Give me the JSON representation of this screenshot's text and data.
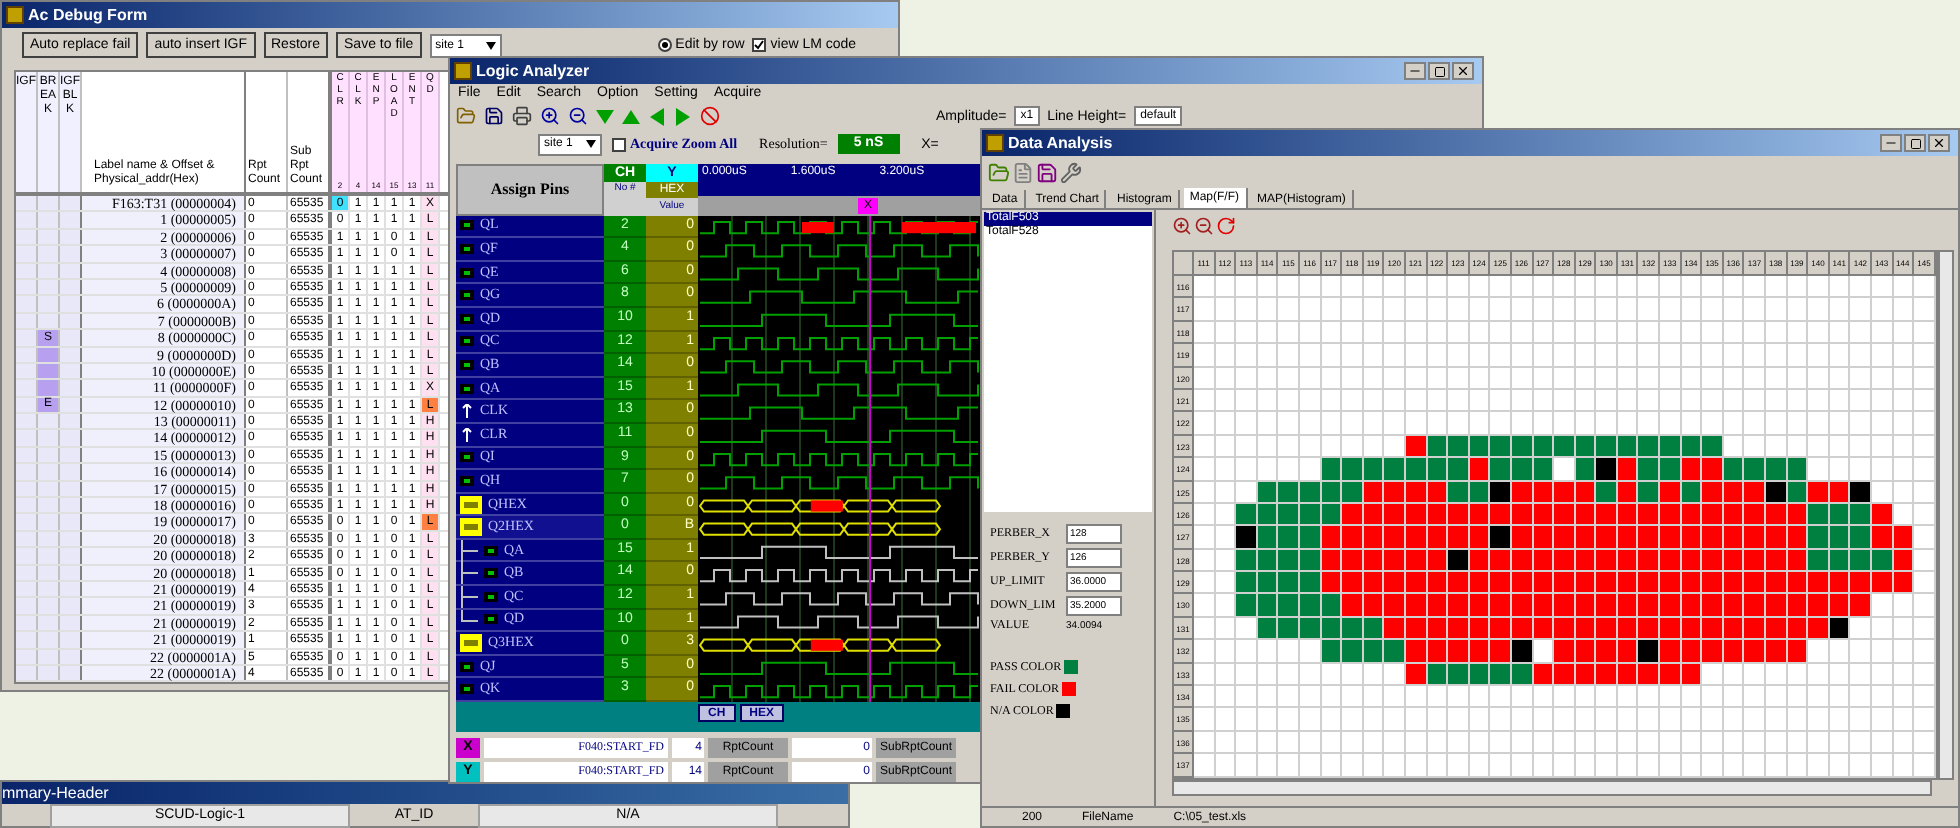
{
  "debug": {
    "title": "Ac Debug Form",
    "buttons": [
      "Auto replace fail",
      "auto insert IGF",
      "Restore",
      "Save to file"
    ],
    "site": "site 1",
    "edit_by_row": {
      "label": "Edit by row",
      "selected": true
    },
    "view_lm_code": {
      "label": "view LM code",
      "checked": true
    },
    "flag_columns": [
      "IGF",
      "BREAK",
      "IGFBLK"
    ],
    "label_header": "Label name & Offset & Physical_addr(Hex)",
    "rpt_header": "Rpt Count",
    "sub_header": "Sub Rpt Count",
    "pin_columns": [
      {
        "name": "CLR",
        "num": "2"
      },
      {
        "name": "CLK",
        "num": "4"
      },
      {
        "name": "ENP",
        "num": "14"
      },
      {
        "name": "LOAD",
        "num": "15"
      },
      {
        "name": "ENT",
        "num": "13"
      },
      {
        "name": "QD",
        "num": "11"
      }
    ],
    "rows": [
      {
        "label": "F163:T31 (00000004)",
        "rpt": "0",
        "sub": "65535",
        "pins": [
          "0",
          "1",
          "1",
          "1",
          "1",
          "X"
        ],
        "cursor": true,
        "fail": false,
        "in_break": false
      },
      {
        "label": "1 (00000005)",
        "rpt": "0",
        "sub": "65535",
        "pins": [
          "0",
          "1",
          "1",
          "1",
          "1",
          "L"
        ],
        "cursor": false,
        "fail": false,
        "in_break": false
      },
      {
        "label": "2 (00000006)",
        "rpt": "0",
        "sub": "65535",
        "pins": [
          "1",
          "1",
          "1",
          "0",
          "1",
          "L"
        ],
        "cursor": false,
        "fail": false,
        "in_break": false
      },
      {
        "label": "3 (00000007)",
        "rpt": "0",
        "sub": "65535",
        "pins": [
          "1",
          "1",
          "1",
          "0",
          "1",
          "L"
        ],
        "cursor": false,
        "fail": false,
        "in_break": false
      },
      {
        "label": "4 (00000008)",
        "rpt": "0",
        "sub": "65535",
        "pins": [
          "1",
          "1",
          "1",
          "1",
          "1",
          "L"
        ],
        "cursor": false,
        "fail": false,
        "in_break": false
      },
      {
        "label": "5 (00000009)",
        "rpt": "0",
        "sub": "65535",
        "pins": [
          "1",
          "1",
          "1",
          "1",
          "1",
          "L"
        ],
        "cursor": false,
        "fail": false,
        "in_break": false
      },
      {
        "label": "6 (0000000A)",
        "rpt": "0",
        "sub": "65535",
        "pins": [
          "1",
          "1",
          "1",
          "1",
          "1",
          "L"
        ],
        "cursor": false,
        "fail": false,
        "in_break": false
      },
      {
        "label": "7 (0000000B)",
        "rpt": "0",
        "sub": "65535",
        "pins": [
          "1",
          "1",
          "1",
          "1",
          "1",
          "L"
        ],
        "cursor": false,
        "fail": false,
        "in_break": false
      },
      {
        "label": "8 (0000000C)",
        "rpt": "0",
        "sub": "65535",
        "pins": [
          "1",
          "1",
          "1",
          "1",
          "1",
          "L"
        ],
        "cursor": false,
        "fail": false,
        "in_break": true,
        "break_label": "S"
      },
      {
        "label": "9 (0000000D)",
        "rpt": "0",
        "sub": "65535",
        "pins": [
          "1",
          "1",
          "1",
          "1",
          "1",
          "L"
        ],
        "cursor": false,
        "fail": false,
        "in_break": true
      },
      {
        "label": "10 (0000000E)",
        "rpt": "0",
        "sub": "65535",
        "pins": [
          "1",
          "1",
          "1",
          "1",
          "1",
          "L"
        ],
        "cursor": false,
        "fail": false,
        "in_break": true
      },
      {
        "label": "11 (0000000F)",
        "rpt": "0",
        "sub": "65535",
        "pins": [
          "1",
          "1",
          "1",
          "1",
          "1",
          "X"
        ],
        "cursor": false,
        "fail": false,
        "in_break": true
      },
      {
        "label": "12 (00000010)",
        "rpt": "0",
        "sub": "65535",
        "pins": [
          "1",
          "1",
          "1",
          "1",
          "1",
          "L"
        ],
        "cursor": false,
        "fail": true,
        "in_break": true,
        "break_label": "E"
      },
      {
        "label": "13 (00000011)",
        "rpt": "0",
        "sub": "65535",
        "pins": [
          "1",
          "1",
          "1",
          "1",
          "1",
          "H"
        ],
        "cursor": false,
        "fail": false,
        "in_break": false
      },
      {
        "label": "14 (00000012)",
        "rpt": "0",
        "sub": "65535",
        "pins": [
          "1",
          "1",
          "1",
          "1",
          "1",
          "H"
        ],
        "cursor": false,
        "fail": false,
        "in_break": false
      },
      {
        "label": "15 (00000013)",
        "rpt": "0",
        "sub": "65535",
        "pins": [
          "1",
          "1",
          "1",
          "1",
          "1",
          "H"
        ],
        "cursor": false,
        "fail": false,
        "in_break": false
      },
      {
        "label": "16 (00000014)",
        "rpt": "0",
        "sub": "65535",
        "pins": [
          "1",
          "1",
          "1",
          "1",
          "1",
          "H"
        ],
        "cursor": false,
        "fail": false,
        "in_break": false
      },
      {
        "label": "17 (00000015)",
        "rpt": "0",
        "sub": "65535",
        "pins": [
          "1",
          "1",
          "1",
          "1",
          "1",
          "H"
        ],
        "cursor": false,
        "fail": false,
        "in_break": false
      },
      {
        "label": "18 (00000016)",
        "rpt": "0",
        "sub": "65535",
        "pins": [
          "1",
          "1",
          "1",
          "1",
          "1",
          "H"
        ],
        "cursor": false,
        "fail": false,
        "in_break": false
      },
      {
        "label": "19 (00000017)",
        "rpt": "0",
        "sub": "65535",
        "pins": [
          "0",
          "1",
          "1",
          "0",
          "1",
          "L"
        ],
        "cursor": false,
        "fail": true,
        "in_break": false
      },
      {
        "label": "20 (00000018)",
        "rpt": "3",
        "sub": "65535",
        "pins": [
          "0",
          "1",
          "1",
          "0",
          "1",
          "L"
        ],
        "cursor": false,
        "fail": false,
        "in_break": false
      },
      {
        "label": "20 (00000018)",
        "rpt": "2",
        "sub": "65535",
        "pins": [
          "0",
          "1",
          "1",
          "0",
          "1",
          "L"
        ],
        "cursor": false,
        "fail": false,
        "in_break": false
      },
      {
        "label": "20 (00000018)",
        "rpt": "1",
        "sub": "65535",
        "pins": [
          "0",
          "1",
          "1",
          "0",
          "1",
          "L"
        ],
        "cursor": false,
        "fail": false,
        "in_break": false
      },
      {
        "label": "21 (00000019)",
        "rpt": "4",
        "sub": "65535",
        "pins": [
          "1",
          "1",
          "1",
          "0",
          "1",
          "L"
        ],
        "cursor": false,
        "fail": false,
        "in_break": false
      },
      {
        "label": "21 (00000019)",
        "rpt": "3",
        "sub": "65535",
        "pins": [
          "1",
          "1",
          "1",
          "0",
          "1",
          "L"
        ],
        "cursor": false,
        "fail": false,
        "in_break": false
      },
      {
        "label": "21 (00000019)",
        "rpt": "2",
        "sub": "65535",
        "pins": [
          "1",
          "1",
          "1",
          "0",
          "1",
          "L"
        ],
        "cursor": false,
        "fail": false,
        "in_break": false
      },
      {
        "label": "21 (00000019)",
        "rpt": "1",
        "sub": "65535",
        "pins": [
          "1",
          "1",
          "1",
          "0",
          "1",
          "L"
        ],
        "cursor": false,
        "fail": false,
        "in_break": false
      },
      {
        "label": "22 (0000001A)",
        "rpt": "5",
        "sub": "65535",
        "pins": [
          "0",
          "1",
          "1",
          "0",
          "1",
          "L"
        ],
        "cursor": false,
        "fail": false,
        "in_break": false
      },
      {
        "label": "22 (0000001A)",
        "rpt": "4",
        "sub": "65535",
        "pins": [
          "0",
          "1",
          "1",
          "0",
          "1",
          "L"
        ],
        "cursor": false,
        "fail": false,
        "in_break": false
      }
    ]
  },
  "logic": {
    "title": "Logic Analyzer",
    "menu": [
      "File",
      "Edit",
      "Search",
      "Option",
      "Setting",
      "Acquire"
    ],
    "amplitude_label": "Amplitude=",
    "amplitude": "x1",
    "line_height_label": "Line Height=",
    "line_height": "default",
    "site": "site 1",
    "acquire_zoom": {
      "label": "Acquire Zoom All",
      "checked": false
    },
    "resolution_label": "Resolution=",
    "resolution": "5 nS",
    "x_label": "X=",
    "headers": {
      "pins": "Assign Pins",
      "ch": "CH",
      "no": "No #",
      "y": "Y",
      "hex": "HEX",
      "value": "Value"
    },
    "time_ticks": [
      "0.000uS",
      "1.600uS",
      "3.200uS"
    ],
    "cursor_label": "X",
    "pins": [
      {
        "name": "QL",
        "ch": "2",
        "value": "0",
        "kind": "output"
      },
      {
        "name": "QF",
        "ch": "4",
        "value": "0",
        "kind": "output"
      },
      {
        "name": "QE",
        "ch": "6",
        "value": "0",
        "kind": "output"
      },
      {
        "name": "QG",
        "ch": "8",
        "value": "0",
        "kind": "output"
      },
      {
        "name": "QD",
        "ch": "10",
        "value": "1",
        "kind": "output"
      },
      {
        "name": "QC",
        "ch": "12",
        "value": "1",
        "kind": "output"
      },
      {
        "name": "QB",
        "ch": "14",
        "value": "0",
        "kind": "output"
      },
      {
        "name": "QA",
        "ch": "15",
        "value": "1",
        "kind": "output"
      },
      {
        "name": "CLK",
        "ch": "13",
        "value": "0",
        "kind": "input"
      },
      {
        "name": "CLR",
        "ch": "11",
        "value": "0",
        "kind": "input"
      },
      {
        "name": "QI",
        "ch": "9",
        "value": "0",
        "kind": "output"
      },
      {
        "name": "QH",
        "ch": "7",
        "value": "0",
        "kind": "output"
      },
      {
        "name": "QHEX",
        "ch": "0",
        "value": "0",
        "kind": "bus"
      },
      {
        "name": "Q2HEX",
        "ch": "0",
        "value": "B",
        "kind": "bus",
        "expanded": true,
        "children": [
          {
            "name": "QA",
            "ch": "15",
            "value": "1",
            "kind": "output"
          },
          {
            "name": "QB",
            "ch": "14",
            "value": "0",
            "kind": "output"
          },
          {
            "name": "QC",
            "ch": "12",
            "value": "1",
            "kind": "output"
          },
          {
            "name": "QD",
            "ch": "10",
            "value": "1",
            "kind": "output"
          }
        ]
      },
      {
        "name": "Q3HEX",
        "ch": "0",
        "value": "3",
        "kind": "bus"
      },
      {
        "name": "QJ",
        "ch": "5",
        "value": "0",
        "kind": "output"
      },
      {
        "name": "QK",
        "ch": "3",
        "value": "0",
        "kind": "output"
      }
    ],
    "bottom_buttons": [
      "CH",
      "HEX"
    ],
    "cursors": [
      {
        "label": "X",
        "color": "#cc00cc",
        "pattern": "F040:START_FD",
        "count": "4",
        "rpt_label": "RptCount",
        "rpt": "0",
        "sub_label": "SubRptCount"
      },
      {
        "label": "Y",
        "color": "#00c0c0",
        "pattern": "F040:START_FD",
        "count": "14",
        "rpt_label": "RptCount",
        "rpt": "0",
        "sub_label": "SubRptCount"
      }
    ]
  },
  "data": {
    "title": "Data Analysis",
    "tabs": [
      {
        "label": "Data",
        "selected": false
      },
      {
        "label": "Trend Chart",
        "selected": false
      },
      {
        "label": "Histogram",
        "selected": false
      },
      {
        "label": "Map(F/F)",
        "selected": true
      },
      {
        "label": "MAP(Histogram)",
        "selected": false
      }
    ],
    "list": [
      {
        "label": "TotalF503",
        "selected": true
      },
      {
        "label": "TotalF528",
        "selected": false
      }
    ],
    "params": [
      {
        "label": "PERBER_X",
        "value": "128"
      },
      {
        "label": "PERBER_Y",
        "value": "126"
      },
      {
        "label": "UP_LIMIT",
        "value": "36.0000"
      },
      {
        "label": "DOWN_LIM",
        "value": "35.2000"
      }
    ],
    "value_label": "VALUE",
    "value": "34.0094",
    "legend": [
      {
        "label": "PASS COLOR",
        "kind": "pass",
        "color": "#008040"
      },
      {
        "label": "FAIL COLOR",
        "kind": "fail",
        "color": "#ff0000"
      },
      {
        "label": "N/A COLOR",
        "kind": "na",
        "color": "#000000"
      }
    ],
    "map": {
      "columns": [
        "111",
        "112",
        "113",
        "114",
        "115",
        "116",
        "117",
        "118",
        "119",
        "120",
        "121",
        "122",
        "123",
        "124",
        "125",
        "126",
        "127",
        "128",
        "129",
        "130",
        "131",
        "132",
        "133",
        "134",
        "135",
        "136",
        "137",
        "138",
        "139",
        "140",
        "141",
        "142",
        "143",
        "144",
        "145"
      ],
      "rows": [
        {
          "label": "116"
        },
        {
          "label": "117"
        },
        {
          "label": "118"
        },
        {
          "label": "119"
        },
        {
          "label": "120"
        },
        {
          "label": "121"
        },
        {
          "label": "122"
        },
        {
          "label": "123",
          "cells": [
            {
              "kind": "blank"
            },
            {
              "kind": "blank"
            },
            {
              "kind": "blank"
            },
            {
              "kind": "blank"
            },
            {
              "kind": "blank"
            },
            {
              "kind": "blank"
            },
            {
              "kind": "blank"
            },
            {
              "kind": "blank"
            },
            {
              "kind": "blank"
            },
            {
              "kind": "blank"
            },
            {
              "kind": "fail"
            },
            {
              "kind": "pass"
            },
            {
              "kind": "pass"
            },
            {
              "kind": "pass"
            },
            {
              "kind": "pass"
            },
            {
              "kind": "pass"
            },
            {
              "kind": "pass"
            },
            {
              "kind": "pass"
            },
            {
              "kind": "pass"
            },
            {
              "kind": "pass"
            },
            {
              "kind": "pass"
            },
            {
              "kind": "pass"
            },
            {
              "kind": "pass"
            },
            {
              "kind": "pass"
            },
            {
              "kind": "pass"
            }
          ]
        },
        {
          "label": "124",
          "cells": [
            {
              "kind": "blank"
            },
            {
              "kind": "blank"
            },
            {
              "kind": "blank"
            },
            {
              "kind": "blank"
            },
            {
              "kind": "blank"
            },
            {
              "kind": "blank"
            },
            {
              "kind": "pass"
            },
            {
              "kind": "pass"
            },
            {
              "kind": "pass"
            },
            {
              "kind": "pass"
            },
            {
              "kind": "pass"
            },
            {
              "kind": "pass"
            },
            {
              "kind": "pass"
            },
            {
              "kind": "fail"
            },
            {
              "kind": "pass"
            },
            {
              "kind": "pass"
            },
            {
              "kind": "pass"
            },
            {
              "kind": "blank"
            },
            {
              "kind": "pass"
            },
            {
              "kind": "na"
            },
            {
              "kind": "fail"
            },
            {
              "kind": "pass"
            },
            {
              "kind": "pass"
            },
            {
              "kind": "fail"
            },
            {
              "kind": "fail"
            },
            {
              "kind": "pass"
            },
            {
              "kind": "pass"
            },
            {
              "kind": "pass"
            },
            {
              "kind": "pass"
            }
          ]
        },
        {
          "label": "125",
          "cells": [
            {
              "kind": "blank"
            },
            {
              "kind": "blank"
            },
            {
              "kind": "blank"
            },
            {
              "kind": "pass"
            },
            {
              "kind": "pass"
            },
            {
              "kind": "pass"
            },
            {
              "kind": "pass"
            },
            {
              "kind": "pass"
            },
            {
              "kind": "fail"
            },
            {
              "kind": "fail"
            },
            {
              "kind": "fail"
            },
            {
              "kind": "fail"
            },
            {
              "kind": "pass"
            },
            {
              "kind": "pass"
            },
            {
              "kind": "na"
            },
            {
              "kind": "fail"
            },
            {
              "kind": "fail"
            },
            {
              "kind": "fail"
            },
            {
              "kind": "fail"
            },
            {
              "kind": "pass"
            },
            {
              "kind": "fail"
            },
            {
              "kind": "pass"
            },
            {
              "kind": "fail"
            },
            {
              "kind": "pass"
            },
            {
              "kind": "fail"
            },
            {
              "kind": "fail"
            },
            {
              "kind": "fail"
            },
            {
              "kind": "na"
            },
            {
              "kind": "pass"
            },
            {
              "kind": "fail"
            },
            {
              "kind": "fail"
            },
            {
              "kind": "na"
            }
          ]
        },
        {
          "label": "126",
          "cells": [
            {
              "kind": "blank"
            },
            {
              "kind": "blank"
            },
            {
              "kind": "pass"
            },
            {
              "kind": "pass"
            },
            {
              "kind": "pass"
            },
            {
              "kind": "pass"
            },
            {
              "kind": "pass"
            },
            {
              "kind": "fail"
            },
            {
              "kind": "fail"
            },
            {
              "kind": "fail"
            },
            {
              "kind": "fail"
            },
            {
              "kind": "fail"
            },
            {
              "kind": "fail"
            },
            {
              "kind": "fail"
            },
            {
              "kind": "fail"
            },
            {
              "kind": "fail"
            },
            {
              "kind": "fail"
            },
            {
              "kind": "fail"
            },
            {
              "kind": "fail"
            },
            {
              "kind": "fail"
            },
            {
              "kind": "fail"
            },
            {
              "kind": "fail"
            },
            {
              "kind": "fail"
            },
            {
              "kind": "fail"
            },
            {
              "kind": "fail"
            },
            {
              "kind": "fail"
            },
            {
              "kind": "fail"
            },
            {
              "kind": "fail"
            },
            {
              "kind": "fail"
            },
            {
              "kind": "pass"
            },
            {
              "kind": "pass"
            },
            {
              "kind": "pass"
            },
            {
              "kind": "fail"
            }
          ]
        },
        {
          "label": "127",
          "cells": [
            {
              "kind": "blank"
            },
            {
              "kind": "blank"
            },
            {
              "kind": "na"
            },
            {
              "kind": "pass"
            },
            {
              "kind": "pass"
            },
            {
              "kind": "pass"
            },
            {
              "kind": "fail"
            },
            {
              "kind": "fail"
            },
            {
              "kind": "fail"
            },
            {
              "kind": "fail"
            },
            {
              "kind": "fail"
            },
            {
              "kind": "fail"
            },
            {
              "kind": "fail"
            },
            {
              "kind": "fail"
            },
            {
              "kind": "na"
            },
            {
              "kind": "fail"
            },
            {
              "kind": "fail"
            },
            {
              "kind": "fail"
            },
            {
              "kind": "fail"
            },
            {
              "kind": "fail"
            },
            {
              "kind": "fail"
            },
            {
              "kind": "fail"
            },
            {
              "kind": "fail"
            },
            {
              "kind": "fail"
            },
            {
              "kind": "fail"
            },
            {
              "kind": "fail"
            },
            {
              "kind": "fail"
            },
            {
              "kind": "fail"
            },
            {
              "kind": "fail"
            },
            {
              "kind": "pass"
            },
            {
              "kind": "pass"
            },
            {
              "kind": "pass"
            },
            {
              "kind": "fail"
            },
            {
              "kind": "fail"
            }
          ]
        },
        {
          "label": "128",
          "cells": [
            {
              "kind": "blank"
            },
            {
              "kind": "blank"
            },
            {
              "kind": "pass"
            },
            {
              "kind": "pass"
            },
            {
              "kind": "pass"
            },
            {
              "kind": "pass"
            },
            {
              "kind": "fail"
            },
            {
              "kind": "fail"
            },
            {
              "kind": "fail"
            },
            {
              "kind": "fail"
            },
            {
              "kind": "fail"
            },
            {
              "kind": "fail"
            },
            {
              "kind": "na"
            },
            {
              "kind": "fail"
            },
            {
              "kind": "fail"
            },
            {
              "kind": "fail"
            },
            {
              "kind": "fail"
            },
            {
              "kind": "fail"
            },
            {
              "kind": "fail"
            },
            {
              "kind": "fail"
            },
            {
              "kind": "fail"
            },
            {
              "kind": "fail"
            },
            {
              "kind": "fail"
            },
            {
              "kind": "fail"
            },
            {
              "kind": "fail"
            },
            {
              "kind": "fail"
            },
            {
              "kind": "fail"
            },
            {
              "kind": "fail"
            },
            {
              "kind": "fail"
            },
            {
              "kind": "pass"
            },
            {
              "kind": "pass"
            },
            {
              "kind": "pass"
            },
            {
              "kind": "pass"
            },
            {
              "kind": "fail"
            }
          ]
        },
        {
          "label": "129",
          "cells": [
            {
              "kind": "blank"
            },
            {
              "kind": "blank"
            },
            {
              "kind": "pass"
            },
            {
              "kind": "pass"
            },
            {
              "kind": "pass"
            },
            {
              "kind": "pass"
            },
            {
              "kind": "fail"
            },
            {
              "kind": "fail"
            },
            {
              "kind": "fail"
            },
            {
              "kind": "fail"
            },
            {
              "kind": "fail"
            },
            {
              "kind": "fail"
            },
            {
              "kind": "fail"
            },
            {
              "kind": "fail"
            },
            {
              "kind": "fail"
            },
            {
              "kind": "fail"
            },
            {
              "kind": "fail"
            },
            {
              "kind": "fail"
            },
            {
              "kind": "fail"
            },
            {
              "kind": "fail"
            },
            {
              "kind": "fail"
            },
            {
              "kind": "fail"
            },
            {
              "kind": "fail"
            },
            {
              "kind": "fail"
            },
            {
              "kind": "fail"
            },
            {
              "kind": "fail"
            },
            {
              "kind": "fail"
            },
            {
              "kind": "fail"
            },
            {
              "kind": "fail"
            },
            {
              "kind": "fail"
            },
            {
              "kind": "fail"
            },
            {
              "kind": "fail"
            },
            {
              "kind": "fail"
            },
            {
              "kind": "fail"
            }
          ]
        },
        {
          "label": "130",
          "cells": [
            {
              "kind": "blank"
            },
            {
              "kind": "blank"
            },
            {
              "kind": "pass"
            },
            {
              "kind": "pass"
            },
            {
              "kind": "pass"
            },
            {
              "kind": "pass"
            },
            {
              "kind": "pass"
            },
            {
              "kind": "fail"
            },
            {
              "kind": "fail"
            },
            {
              "kind": "fail"
            },
            {
              "kind": "fail"
            },
            {
              "kind": "fail"
            },
            {
              "kind": "fail"
            },
            {
              "kind": "fail"
            },
            {
              "kind": "fail"
            },
            {
              "kind": "fail"
            },
            {
              "kind": "fail"
            },
            {
              "kind": "fail"
            },
            {
              "kind": "fail"
            },
            {
              "kind": "fail"
            },
            {
              "kind": "fail"
            },
            {
              "kind": "fail"
            },
            {
              "kind": "fail"
            },
            {
              "kind": "fail"
            },
            {
              "kind": "fail"
            },
            {
              "kind": "fail"
            },
            {
              "kind": "fail"
            },
            {
              "kind": "fail"
            },
            {
              "kind": "fail"
            },
            {
              "kind": "fail"
            },
            {
              "kind": "fail"
            },
            {
              "kind": "fail"
            }
          ]
        },
        {
          "label": "131",
          "cells": [
            {
              "kind": "blank"
            },
            {
              "kind": "blank"
            },
            {
              "kind": "blank"
            },
            {
              "kind": "pass"
            },
            {
              "kind": "pass"
            },
            {
              "kind": "pass"
            },
            {
              "kind": "pass"
            },
            {
              "kind": "pass"
            },
            {
              "kind": "pass"
            },
            {
              "kind": "fail"
            },
            {
              "kind": "fail"
            },
            {
              "kind": "fail"
            },
            {
              "kind": "fail"
            },
            {
              "kind": "fail"
            },
            {
              "kind": "fail"
            },
            {
              "kind": "fail"
            },
            {
              "kind": "fail"
            },
            {
              "kind": "fail"
            },
            {
              "kind": "fail"
            },
            {
              "kind": "fail"
            },
            {
              "kind": "fail"
            },
            {
              "kind": "fail"
            },
            {
              "kind": "fail"
            },
            {
              "kind": "fail"
            },
            {
              "kind": "fail"
            },
            {
              "kind": "fail"
            },
            {
              "kind": "fail"
            },
            {
              "kind": "fail"
            },
            {
              "kind": "fail"
            },
            {
              "kind": "fail"
            },
            {
              "kind": "na"
            }
          ]
        },
        {
          "label": "132",
          "cells": [
            {
              "kind": "blank"
            },
            {
              "kind": "blank"
            },
            {
              "kind": "blank"
            },
            {
              "kind": "blank"
            },
            {
              "kind": "blank"
            },
            {
              "kind": "blank"
            },
            {
              "kind": "pass"
            },
            {
              "kind": "pass"
            },
            {
              "kind": "pass"
            },
            {
              "kind": "pass"
            },
            {
              "kind": "fail"
            },
            {
              "kind": "fail"
            },
            {
              "kind": "fail"
            },
            {
              "kind": "fail"
            },
            {
              "kind": "fail"
            },
            {
              "kind": "na"
            },
            {
              "kind": "blank"
            },
            {
              "kind": "fail"
            },
            {
              "kind": "fail"
            },
            {
              "kind": "fail"
            },
            {
              "kind": "fail"
            },
            {
              "kind": "na"
            },
            {
              "kind": "fail"
            },
            {
              "kind": "fail"
            },
            {
              "kind": "fail"
            },
            {
              "kind": "fail"
            },
            {
              "kind": "fail"
            },
            {
              "kind": "fail"
            },
            {
              "kind": "fail"
            }
          ]
        },
        {
          "label": "133",
          "cells": [
            {
              "kind": "blank"
            },
            {
              "kind": "blank"
            },
            {
              "kind": "blank"
            },
            {
              "kind": "blank"
            },
            {
              "kind": "blank"
            },
            {
              "kind": "blank"
            },
            {
              "kind": "blank"
            },
            {
              "kind": "blank"
            },
            {
              "kind": "blank"
            },
            {
              "kind": "blank"
            },
            {
              "kind": "fail"
            },
            {
              "kind": "pass"
            },
            {
              "kind": "pass"
            },
            {
              "kind": "pass"
            },
            {
              "kind": "pass"
            },
            {
              "kind": "pass"
            },
            {
              "kind": "fail"
            },
            {
              "kind": "fail"
            },
            {
              "kind": "fail"
            },
            {
              "kind": "fail"
            },
            {
              "kind": "fail"
            },
            {
              "kind": "fail"
            },
            {
              "kind": "fail"
            },
            {
              "kind": "fail"
            }
          ]
        },
        {
          "label": "134"
        },
        {
          "label": "135"
        },
        {
          "label": "136"
        },
        {
          "label": "137"
        }
      ]
    },
    "status": [
      "200",
      "FileName",
      "C:\\05_test.xls"
    ]
  },
  "summary": {
    "title": "mmary-Header",
    "fields": [
      {
        "label": "SCUD-Logic-1"
      },
      {
        "label": "AT_ID"
      },
      {
        "label": "N/A"
      }
    ]
  }
}
